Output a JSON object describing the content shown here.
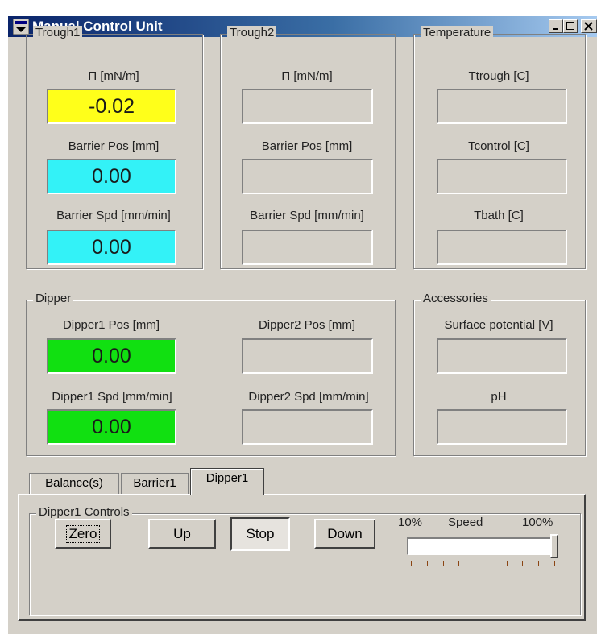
{
  "window": {
    "title": "Manual Control Unit"
  },
  "trough1": {
    "legend": "Trough1",
    "pi_label": "Π  [mN/m]",
    "pi_value": "-0.02",
    "barrier_pos_label": "Barrier Pos [mm]",
    "barrier_pos_value": "0.00",
    "barrier_spd_label": "Barrier Spd [mm/min]",
    "barrier_spd_value": "0.00"
  },
  "trough2": {
    "legend": "Trough2",
    "pi_label": "Π  [mN/m]",
    "barrier_pos_label": "Barrier Pos [mm]",
    "barrier_spd_label": "Barrier Spd [mm/min]"
  },
  "temperature": {
    "legend": "Temperature",
    "ttrough_label": "Ttrough [C]",
    "tcontrol_label": "Tcontrol [C]",
    "tbath_label": "Tbath [C]"
  },
  "dipper": {
    "legend": "Dipper",
    "d1pos_label": "Dipper1 Pos [mm]",
    "d1pos_value": "0.00",
    "d2pos_label": "Dipper2 Pos [mm]",
    "d1spd_label": "Dipper1 Spd [mm/min]",
    "d1spd_value": "0.00",
    "d2spd_label": "Dipper2 Spd [mm/min]"
  },
  "accessories": {
    "legend": "Accessories",
    "surface_label": "Surface potential [V]",
    "ph_label": "pH"
  },
  "tabs": [
    "Balance(s)",
    "Barrier1",
    "Dipper1"
  ],
  "controls": {
    "legend": "Dipper1 Controls",
    "zero": "Zero",
    "up": "Up",
    "stop": "Stop",
    "down": "Down",
    "slider_min": "10%",
    "slider_label": "Speed",
    "slider_max": "100%",
    "speed_fraction": 1.0
  },
  "colors": {
    "pi": "#ffff1a",
    "barrier": "#33f2f7",
    "dipper": "#11e011"
  }
}
